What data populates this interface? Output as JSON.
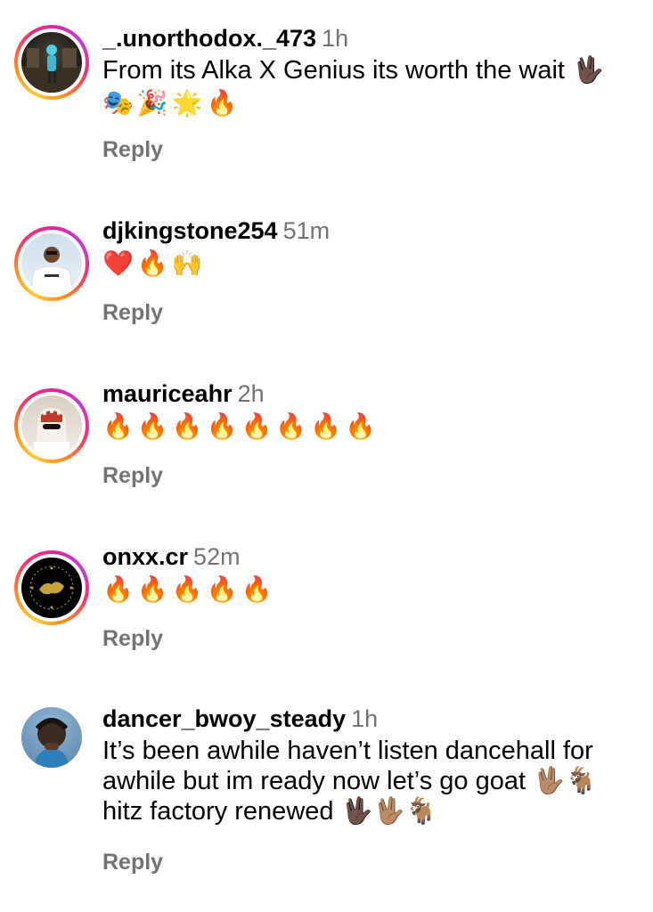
{
  "comments": [
    {
      "username": "_.unorthodox._473",
      "time": "1h",
      "text": "From its Alka X Genius its worth the wait 🖖🏿",
      "text2": "🎭🎉🌟🔥",
      "reply_label": "Reply",
      "has_story_ring": true,
      "avatar_colors": [
        "#1b1a17",
        "#6b5a44"
      ]
    },
    {
      "username": "djkingstone254",
      "time": "51m",
      "text": "❤️🔥🙌",
      "reply_label": "Reply",
      "has_story_ring": true,
      "avatar_colors": [
        "#d8e6f2",
        "#ffffff"
      ]
    },
    {
      "username": "mauriceahr",
      "time": "2h",
      "text": "🔥🔥🔥🔥🔥🔥🔥🔥",
      "reply_label": "Reply",
      "has_story_ring": true,
      "avatar_colors": [
        "#d9cfc4",
        "#f2ece6"
      ]
    },
    {
      "username": "onxx.cr",
      "time": "52m",
      "text": "🔥🔥🔥🔥🔥",
      "reply_label": "Reply",
      "has_story_ring": true,
      "avatar_colors": [
        "#000000",
        "#c9a23a"
      ]
    },
    {
      "username": "dancer_bwoy_steady",
      "time": "1h",
      "text": "It’s been awhile haven’t listen dancehall for awhile but im ready now let’s go goat 🖖🏽🐐 hitz factory renewed 🖖🏿🖖🏽🐐",
      "reply_label": "Reply",
      "has_story_ring": false,
      "avatar_colors": [
        "#3a2a22",
        "#8fb7d9"
      ]
    }
  ],
  "colors": {
    "secondary_text": "#737373",
    "primary_text": "#000000",
    "background": "#ffffff"
  }
}
